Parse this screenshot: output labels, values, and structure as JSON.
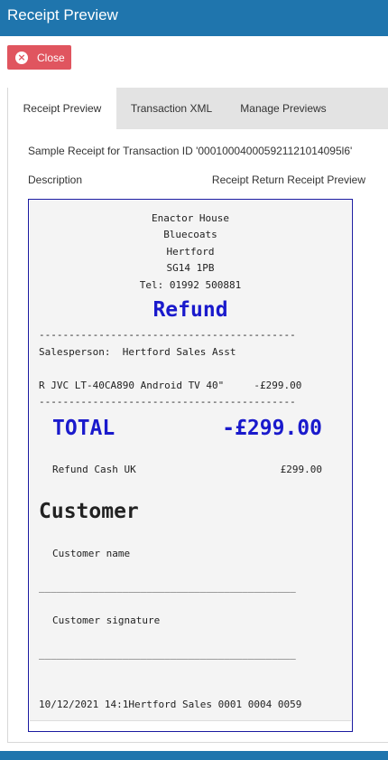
{
  "header": {
    "title": "Receipt Preview"
  },
  "actions": {
    "close_label": "Close"
  },
  "tabs": [
    {
      "label": "Receipt Preview"
    },
    {
      "label": "Transaction XML"
    },
    {
      "label": "Manage Previews"
    }
  ],
  "content": {
    "info": "Sample Receipt for Transaction ID '000100040005921121014095l6'",
    "description_label": "Description",
    "description_value": "Receipt Return Receipt Preview"
  },
  "receipt": {
    "address": [
      "Enactor House",
      "Bluecoats",
      "Hertford",
      "SG14 1PB",
      "Tel: 01992 500881"
    ],
    "heading": "Refund",
    "divider": "-------------------------------------------",
    "salesperson": "Salesperson:  Hertford Sales Asst",
    "item_line": "R JVC LT-40CA890 Android TV 40\"     -£299.00",
    "total_label": "TOTAL",
    "total_value": "-£299.00",
    "tender_label": "Refund Cash UK",
    "tender_value": "£299.00",
    "customer_heading": "Customer",
    "customer_name_label": "Customer name",
    "signature_line": "___________________________________________",
    "customer_signature_label": "Customer signature",
    "footer": "10/12/2021 14:1Hertford Sales 0001 0004 0059"
  }
}
